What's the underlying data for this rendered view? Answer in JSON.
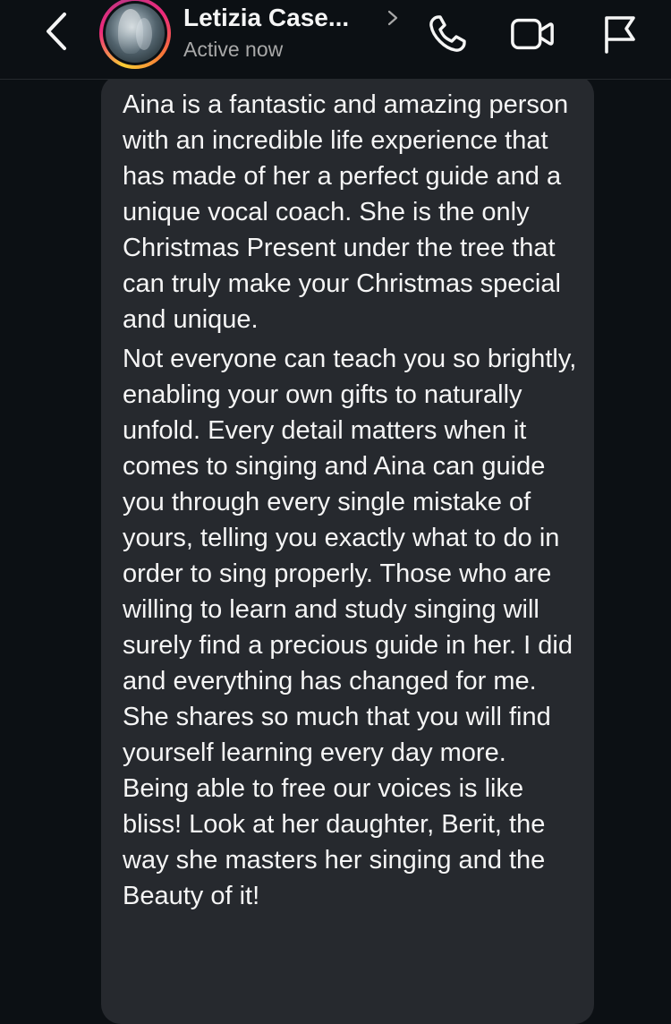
{
  "header": {
    "contact_name": "Letizia Case...",
    "status": "Active now",
    "icons": {
      "back": "chevron-left-icon",
      "profile_chevron": "chevron-right-icon",
      "call": "phone-icon",
      "video": "video-camera-icon",
      "report": "flag-icon"
    }
  },
  "message": {
    "paragraph_1": "Aina is a fantastic and amazing person with an incredible life experience that has made of her a perfect guide and a unique vocal coach. She is the only Christmas Present under the tree that can truly make your Christmas special and unique.",
    "paragraph_2": "Not everyone can teach you so brightly,  enabling your own gifts to naturally unfold. Every detail matters when it comes to singing and Aina can guide you through every single mistake of yours, telling you exactly what to do in order to sing properly. Those who are willing to learn and study singing will surely find a precious guide in her. I did and everything has changed for me. She shares so much that you will find yourself learning every day more. Being able to free our voices is like bliss! Look at her daughter, Berit, the way she masters her singing and the Beauty of it!"
  },
  "colors": {
    "background": "#0c1014",
    "bubble": "#26292e",
    "text": "#f5f5f5",
    "secondary_text": "#a8a8a8"
  }
}
